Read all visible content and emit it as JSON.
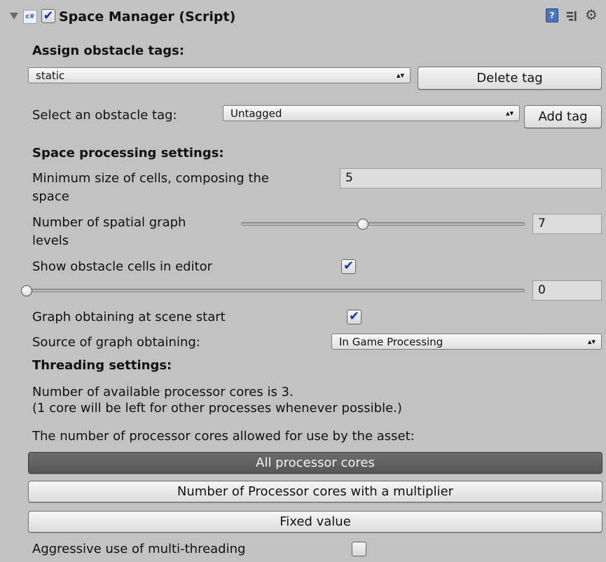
{
  "header": {
    "title": "Space Manager (Script)",
    "enabled": true,
    "script_icon_label": "c#",
    "icons": [
      "foldout-arrow-icon",
      "csharp-script-icon",
      "help-book-icon",
      "presets-icon",
      "gear-icon"
    ]
  },
  "assign": {
    "heading": "Assign obstacle tags:",
    "tag_selected": "static",
    "delete_label": "Delete tag",
    "select_label": "Select an obstacle tag:",
    "select_value": "Untagged",
    "add_label": "Add tag"
  },
  "space": {
    "heading": "Space processing settings:",
    "min_cell_label_1": "Minimum size of cells, composing the",
    "min_cell_label_2": "space",
    "min_cell_value": "5",
    "levels_label_1": "Number of spatial graph",
    "levels_label_2": "levels",
    "levels_value": "7",
    "levels_slider_fraction": 0.43,
    "show_cells_label": "Show obstacle cells in editor",
    "show_cells_checked": true,
    "cells_slider_value": "0",
    "cells_slider_fraction": 0.0,
    "graph_start_label": "Graph obtaining at scene start",
    "graph_start_checked": true,
    "source_label": "Source of graph obtaining:",
    "source_value": "In Game Processing"
  },
  "threading": {
    "heading": "Threading settings:",
    "info_1": "Number of available processor cores is 3.",
    "info_2": "(1 core will be left for other processes whenever possible.)",
    "allowed_label": "The number of processor cores allowed for use by the asset:",
    "options": [
      "All processor cores",
      "Number of Processor cores with a multiplier",
      "Fixed value"
    ],
    "selected_option": 0,
    "aggressive_label": "Aggressive use of multi-threading",
    "aggressive_checked": false
  },
  "colors": {
    "panel_bg": "#c2c2c2",
    "selected_button_bg": "#5f5f5f",
    "checkmark": "#1c3aa6"
  }
}
